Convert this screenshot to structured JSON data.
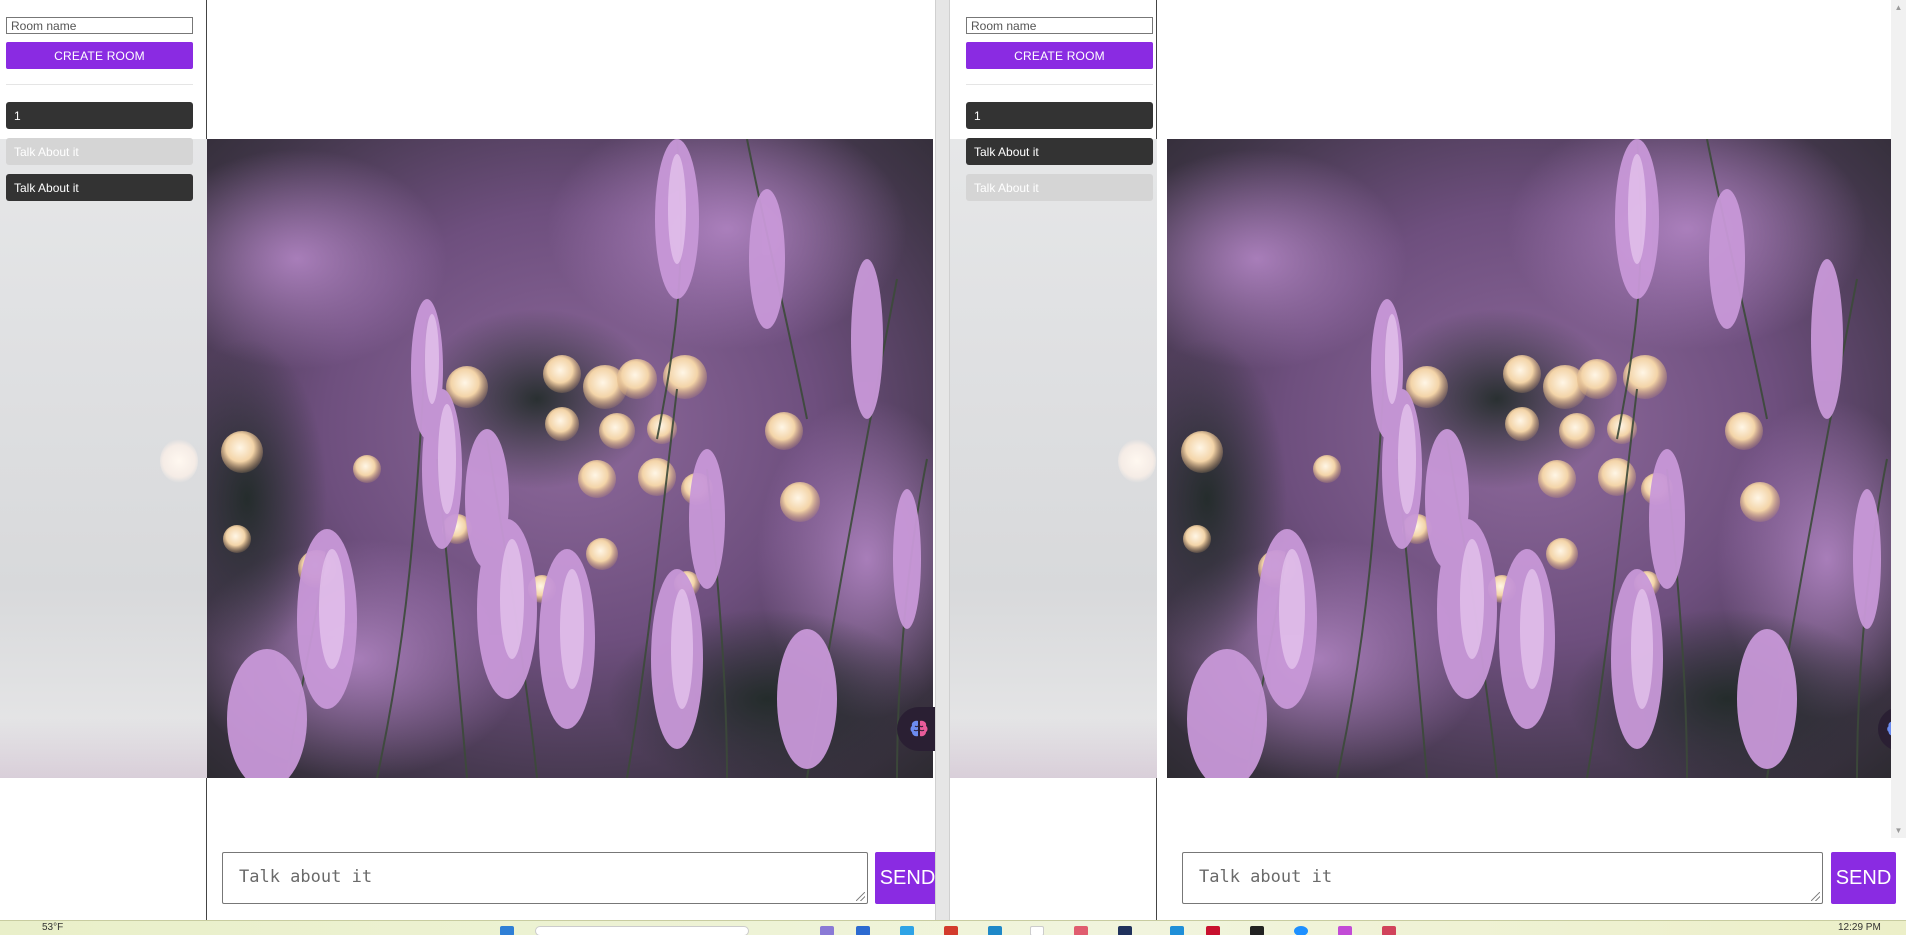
{
  "panes": [
    {
      "sidebar": {
        "room_input_placeholder": "Room name",
        "create_button_label": "CREATE ROOM",
        "rooms": [
          {
            "label": "1",
            "state": "dark"
          },
          {
            "label": "Talk About it",
            "state": "light"
          },
          {
            "label": "Talk About it",
            "state": "dark"
          }
        ]
      },
      "composer": {
        "placeholder": "Talk about it",
        "send_label": "SEND"
      }
    },
    {
      "sidebar": {
        "room_input_placeholder": "Room name",
        "create_button_label": "CREATE ROOM",
        "rooms": [
          {
            "label": "1",
            "state": "dark"
          },
          {
            "label": "Talk About it",
            "state": "dark"
          },
          {
            "label": "Talk About it",
            "state": "light"
          }
        ]
      },
      "composer": {
        "placeholder": "Talk about it",
        "send_label": "SEND"
      }
    }
  ],
  "taskbar": {
    "weather": "53°F",
    "clock": "12:29 PM"
  },
  "colors": {
    "accent": "#8a2be2",
    "room_active": "#333333",
    "room_inactive": "#d5d5d5"
  },
  "icons": {
    "floating_badge": "brain-icon",
    "scroll_up": "triangle-up-icon",
    "scroll_down": "triangle-down-icon"
  }
}
